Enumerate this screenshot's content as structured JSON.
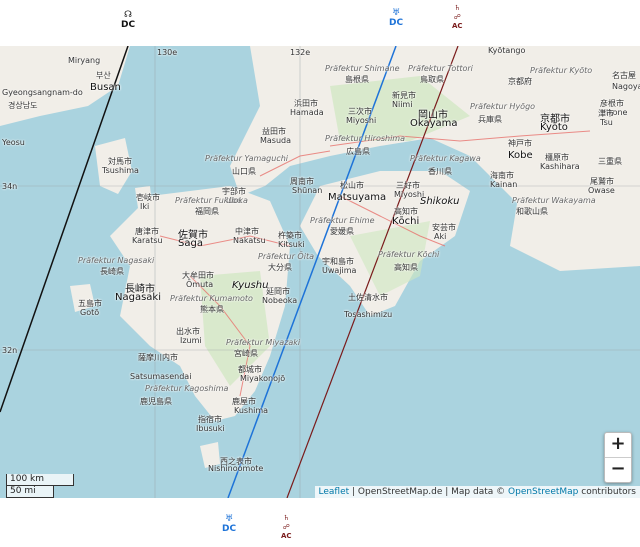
{
  "markers_top": [
    {
      "id": "black",
      "symbol": "☊",
      "code": "DC",
      "color": "#111111"
    },
    {
      "id": "blue",
      "symbol": "♅",
      "code": "DC",
      "color": "#1e73d8"
    },
    {
      "id": "brown",
      "symbol": "♄",
      "sub": "☍",
      "code": "AC",
      "color": "#7a1b1b"
    }
  ],
  "markers_bottom": [
    {
      "id": "blue",
      "symbol": "♅",
      "code": "DC",
      "color": "#1e73d8"
    },
    {
      "id": "brown",
      "symbol": "♄",
      "sub": "☍",
      "code": "AC",
      "color": "#7a1b1b"
    }
  ],
  "grid": {
    "lon_labels": [
      "130e",
      "132e"
    ],
    "lat_labels": [
      "34n",
      "32n"
    ]
  },
  "places": [
    {
      "text": "Kyōtango"
    },
    {
      "text": "Präfektur Shimane"
    },
    {
      "text": "Präfektur Tottori"
    },
    {
      "text": "Präfektur Kyōto"
    },
    {
      "text": "名古屋"
    },
    {
      "text": "Nagoya"
    },
    {
      "text": "島根県"
    },
    {
      "text": "鳥取県"
    },
    {
      "text": "京都府"
    },
    {
      "text": "浜田市"
    },
    {
      "text": "Hamada"
    },
    {
      "text": "三次市"
    },
    {
      "text": "Miyoshi"
    },
    {
      "text": "新見市"
    },
    {
      "text": "Niimi"
    },
    {
      "text": "Präfektur Hyōgo"
    },
    {
      "text": "彦根市"
    },
    {
      "text": "Hikone"
    },
    {
      "text": "津市"
    },
    {
      "text": "Tsu"
    },
    {
      "text": "岡山市"
    },
    {
      "text": "Okayama"
    },
    {
      "text": "兵庫県"
    },
    {
      "text": "京都市"
    },
    {
      "text": "Kyōto"
    },
    {
      "text": "益田市"
    },
    {
      "text": "Masuda"
    },
    {
      "text": "Präfektur Hiroshima"
    },
    {
      "text": "広島県"
    },
    {
      "text": "神戸市"
    },
    {
      "text": "Kobe"
    },
    {
      "text": "Präfektur Yamaguchi"
    },
    {
      "text": "山口県"
    },
    {
      "text": "Präfektur Kagawa"
    },
    {
      "text": "香川県"
    },
    {
      "text": "橿原市"
    },
    {
      "text": "Kashihara"
    },
    {
      "text": "三重県"
    },
    {
      "text": "尾鷲市"
    },
    {
      "text": "Owase"
    },
    {
      "text": "周南市"
    },
    {
      "text": "Shūnan"
    },
    {
      "text": "松山市"
    },
    {
      "text": "Matsuyama"
    },
    {
      "text": "三好市"
    },
    {
      "text": "Miyoshi"
    },
    {
      "text": "Shikoku"
    },
    {
      "text": "海南市"
    },
    {
      "text": "Kainan"
    },
    {
      "text": "Präfektur Wakayama"
    },
    {
      "text": "和歌山県"
    },
    {
      "text": "宇部市"
    },
    {
      "text": "Ube"
    },
    {
      "text": "Präfektur Fukuoka"
    },
    {
      "text": "福岡県"
    },
    {
      "text": "Präfektur Ehime"
    },
    {
      "text": "愛媛県"
    },
    {
      "text": "高知市"
    },
    {
      "text": "Kōchi"
    },
    {
      "text": "安芸市"
    },
    {
      "text": "Aki"
    },
    {
      "text": "佐賀市"
    },
    {
      "text": "Saga"
    },
    {
      "text": "中津市"
    },
    {
      "text": "Nakatsu"
    },
    {
      "text": "杵築市"
    },
    {
      "text": "Kitsuki"
    },
    {
      "text": "唐津市"
    },
    {
      "text": "Karatsu"
    },
    {
      "text": "Präfektur Ōita"
    },
    {
      "text": "大分県"
    },
    {
      "text": "宇和島市"
    },
    {
      "text": "Uwajima"
    },
    {
      "text": "Präfektur Kōchi"
    },
    {
      "text": "高知県"
    },
    {
      "text": "Präfektur Nagasaki"
    },
    {
      "text": "長崎県"
    },
    {
      "text": "大牟田市"
    },
    {
      "text": "Ōmuta"
    },
    {
      "text": "長崎市"
    },
    {
      "text": "Nagasaki"
    },
    {
      "text": "Kyushu"
    },
    {
      "text": "延岡市"
    },
    {
      "text": "Nobeoka"
    },
    {
      "text": "土佐清水市"
    },
    {
      "text": "Tosashimizu"
    },
    {
      "text": "五島市"
    },
    {
      "text": "Gotō"
    },
    {
      "text": "Präfektur Kumamoto"
    },
    {
      "text": "熊本県"
    },
    {
      "text": "出水市"
    },
    {
      "text": "Izumi"
    },
    {
      "text": "Präfektur Miyazaki"
    },
    {
      "text": "宮崎県"
    },
    {
      "text": "薩摩川内市"
    },
    {
      "text": "Satsumasendai"
    },
    {
      "text": "都城市"
    },
    {
      "text": "Miyakonojō"
    },
    {
      "text": "Präfektur Kagoshima"
    },
    {
      "text": "鹿児島県"
    },
    {
      "text": "鹿屋市"
    },
    {
      "text": "Kushima"
    },
    {
      "text": "指宿市"
    },
    {
      "text": "Ibusuki"
    },
    {
      "text": "西之表市"
    },
    {
      "text": "Nishinoomote"
    },
    {
      "text": "対馬市"
    },
    {
      "text": "Tsushima"
    },
    {
      "text": "壱岐市"
    },
    {
      "text": "Iki"
    },
    {
      "text": "Busan"
    },
    {
      "text": "Miryang"
    },
    {
      "text": "부산"
    },
    {
      "text": "Gyeongsangnam-do"
    },
    {
      "text": "경상남도"
    },
    {
      "text": "Yeosu"
    },
    {
      "text": "50 mi"
    }
  ],
  "zoom": {
    "in": "+",
    "out": "−"
  },
  "scale": {
    "km": "100 km",
    "mi": "50 mi"
  },
  "attribution": {
    "leaflet": "Leaflet",
    "sep1": " | OpenStreetMap.de | Map data © ",
    "osm": "OpenStreetMap",
    "tail": " contributors"
  }
}
